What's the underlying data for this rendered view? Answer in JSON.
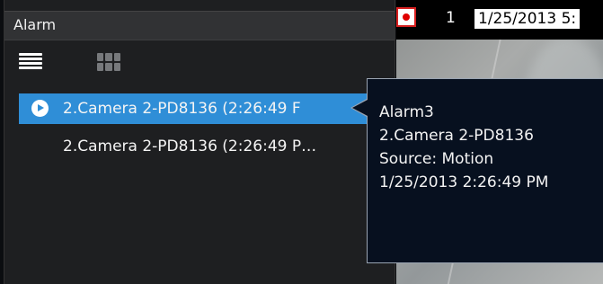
{
  "video": {
    "channel": "1",
    "datetime": "1/25/2013 5:"
  },
  "alarm_panel": {
    "title": "Alarm",
    "view_icons": [
      "list-view-icon",
      "grid-view-icon"
    ],
    "rows": [
      {
        "text": "2.Camera 2-PD8136 (2:26:49 F",
        "selected": true
      },
      {
        "text": "2.Camera 2-PD8136 (2:26:49 P…",
        "selected": false
      }
    ]
  },
  "tooltip": {
    "lines": [
      "Alarm3",
      "2.Camera 2-PD8136",
      "Source: Motion",
      "1/25/2013 2:26:49 PM"
    ]
  },
  "colors": {
    "selection": "#2f8ed7",
    "recording": "#e00000",
    "panel_bg": "#1e1f21",
    "tooltip_bg": "#07101f"
  }
}
